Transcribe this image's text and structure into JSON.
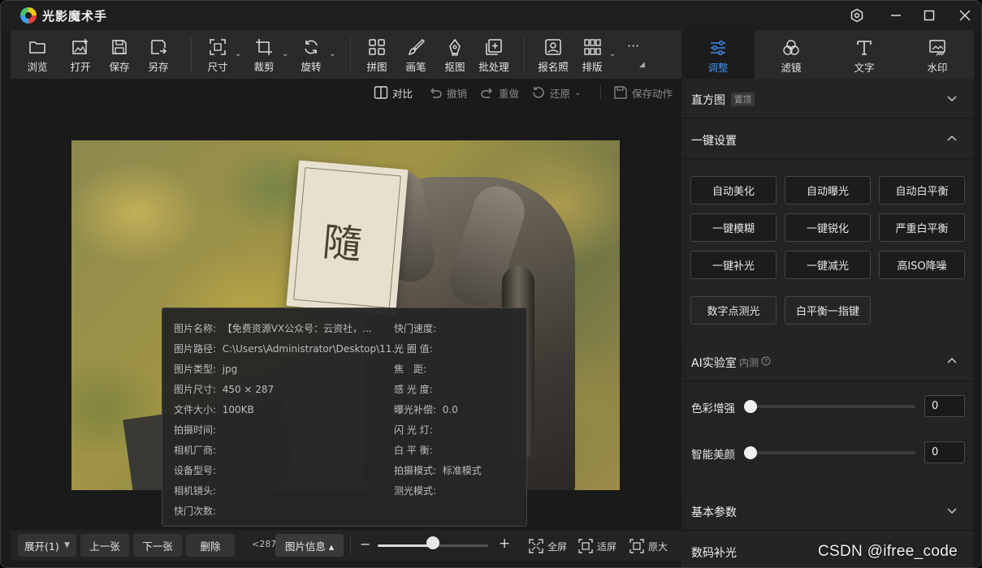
{
  "app": {
    "title": "光影魔术手"
  },
  "toolbar": {
    "items": [
      {
        "label": "浏览",
        "icon": "folder-icon"
      },
      {
        "label": "打开",
        "icon": "open-image-icon"
      },
      {
        "label": "保存",
        "icon": "save-icon"
      },
      {
        "label": "另存",
        "icon": "save-as-icon"
      },
      {
        "label": "尺寸",
        "icon": "resize-icon"
      },
      {
        "label": "裁剪",
        "icon": "crop-icon"
      },
      {
        "label": "旋转",
        "icon": "rotate-icon"
      },
      {
        "label": "拼图",
        "icon": "collage-icon"
      },
      {
        "label": "画笔",
        "icon": "brush-icon"
      },
      {
        "label": "抠图",
        "icon": "cutout-pen-icon"
      },
      {
        "label": "批处理",
        "icon": "batch-icon"
      },
      {
        "label": "报名照",
        "icon": "id-photo-icon"
      },
      {
        "label": "排版",
        "icon": "layout-grid-icon"
      }
    ],
    "more": "···"
  },
  "right_tabs": [
    {
      "label": "调整",
      "icon": "sliders-icon",
      "active": true
    },
    {
      "label": "滤镜",
      "icon": "filter-icon",
      "active": false
    },
    {
      "label": "文字",
      "icon": "text-icon",
      "active": false
    },
    {
      "label": "水印",
      "icon": "watermark-icon",
      "active": false
    }
  ],
  "subtoolbar": {
    "compare": "对比",
    "undo": "撤销",
    "redo": "重做",
    "restore": "还原",
    "save_action": "保存动作"
  },
  "info": {
    "left": [
      {
        "k": "图片名称:",
        "v": "【免费资源VX公众号：云资社，..."
      },
      {
        "k": "图片路径:",
        "v": "C:\\Users\\Administrator\\Desktop\\11..."
      },
      {
        "k": "图片类型:",
        "v": "jpg"
      },
      {
        "k": "图片尺寸:",
        "v": "450 × 287"
      },
      {
        "k": "文件大小:",
        "v": "100KB"
      },
      {
        "k": "拍摄时间:",
        "v": ""
      },
      {
        "k": "相机厂商:",
        "v": ""
      },
      {
        "k": "设备型号:",
        "v": ""
      },
      {
        "k": "相机镜头:",
        "v": ""
      },
      {
        "k": "快门次数:",
        "v": ""
      }
    ],
    "right": [
      {
        "k": "快门速度:",
        "v": ""
      },
      {
        "k": "光 圈 值:",
        "v": ""
      },
      {
        "k": "焦　距:",
        "v": ""
      },
      {
        "k": "感 光 度:",
        "v": ""
      },
      {
        "k": "曝光补偿:",
        "v": "0.0"
      },
      {
        "k": "闪 光 灯:",
        "v": ""
      },
      {
        "k": "白 平 衡:",
        "v": ""
      },
      {
        "k": "拍摄模式:",
        "v": "标准模式"
      },
      {
        "k": "测光模式:",
        "v": ""
      }
    ]
  },
  "photo": {
    "glyph": "隨"
  },
  "bottombar": {
    "expand": "展开(1)",
    "prev": "上一张",
    "next": "下一张",
    "delete": "删除",
    "count": "<287",
    "info_button": "图片信息 ▴",
    "zoom_minus": "−",
    "zoom_plus": "+",
    "zoom_level": 0.5,
    "fullscreen": "全屏",
    "fit": "适屏",
    "original": "原大"
  },
  "panel": {
    "histogram": {
      "title": "直方图",
      "tag": "置顶"
    },
    "onekey": {
      "title": "一键设置",
      "buttons": [
        "自动美化",
        "自动曝光",
        "自动白平衡",
        "一键模糊",
        "一键锐化",
        "严重白平衡",
        "一键补光",
        "一键减光",
        "高ISO降噪",
        "数字点测光",
        "白平衡一指键"
      ]
    },
    "ailab": {
      "title": "AI实验室",
      "sub": "内测",
      "sliders": [
        {
          "label": "色彩增强",
          "value": "0"
        },
        {
          "label": "智能美颜",
          "value": "0"
        }
      ]
    },
    "basic": {
      "title": "基本参数"
    },
    "digital": {
      "title": "数码补光"
    }
  },
  "watermark": "CSDN @ifree_code",
  "colors": {
    "accent": "#3d8cf0",
    "background": "#1b1b1b"
  }
}
